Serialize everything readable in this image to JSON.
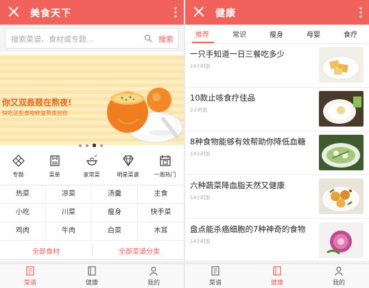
{
  "left_screen": {
    "header": {
      "title": "美食天下"
    },
    "search": {
      "placeholder": "搜索菜谱、食材或专题...",
      "button_label": "搜索"
    },
    "banner": {
      "title": "你又双叒叕在熬夜!",
      "subtitle": "快吃这些食物修复熬夜创伤",
      "dot_count": 4,
      "active_dot": 3
    },
    "categories": [
      {
        "label": "专题",
        "icon": "diamond-grid-icon"
      },
      {
        "label": "菜单",
        "icon": "menu-book-icon"
      },
      {
        "label": "家常菜",
        "icon": "cooking-pot-icon"
      },
      {
        "label": "明星菜谱",
        "icon": "gem-icon"
      },
      {
        "label": "一周热门",
        "icon": "calendar-week-icon"
      }
    ],
    "grid_rows": [
      [
        "热菜",
        "凉菜",
        "汤羹",
        "主食"
      ],
      [
        "小吃",
        "川菜",
        "瘦身",
        "快手菜"
      ],
      [
        "鸡肉",
        "牛肉",
        "白菜",
        "木耳"
      ]
    ],
    "links": {
      "all_ingredients": "全部食材",
      "all_categories": "全部菜谱分类"
    }
  },
  "right_screen": {
    "header": {
      "title": "健康"
    },
    "tabs": [
      "推荐",
      "常识",
      "瘦身",
      "母婴",
      "食疗"
    ],
    "active_tab": 0,
    "articles": [
      {
        "title": "一只手知道一日三餐吃多少",
        "time": "14小时前"
      },
      {
        "title": "10款止咳食疗佳品",
        "time": "2小时前"
      },
      {
        "title": "8种食物能够有效帮助你降低血糖",
        "time": "14小时前"
      },
      {
        "title": "六种蔬菜降血脂天然又健康",
        "time": "14小时前"
      },
      {
        "title": "盘点能杀癌细胞的7种神奇的食物",
        "time": "14小时前"
      }
    ]
  },
  "tabbar": {
    "items": [
      {
        "label": "菜谱",
        "icon": "recipe-book-icon"
      },
      {
        "label": "健康",
        "icon": "health-book-icon"
      },
      {
        "label": "我的",
        "icon": "user-icon"
      }
    ]
  },
  "colors": {
    "brand": "#f2625d",
    "banner_text": "#e8661a"
  }
}
